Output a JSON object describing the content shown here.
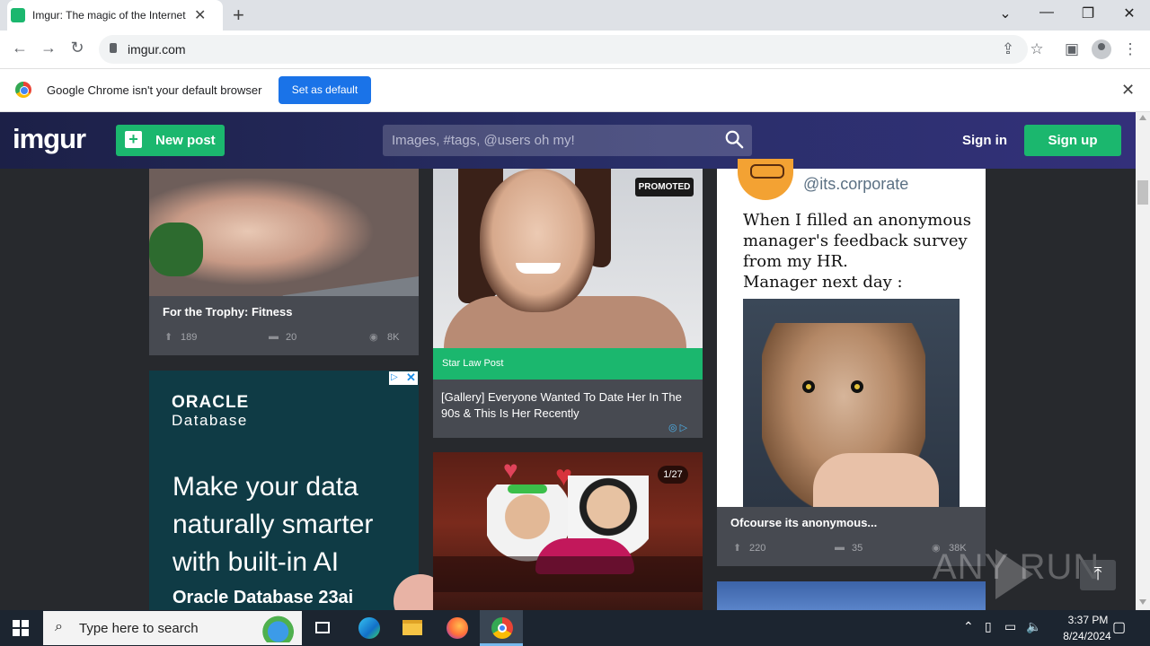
{
  "browser": {
    "tab_title": "Imgur: The magic of the Internet",
    "url": "imgur.com",
    "infobar_text": "Google Chrome isn't your default browser",
    "set_default_label": "Set as default"
  },
  "header": {
    "logo": "imgur",
    "new_post_label": "New post",
    "search_placeholder": "Images, #tags, @users oh my!",
    "signin_label": "Sign in",
    "signup_label": "Sign up"
  },
  "cards": [
    {
      "title": "For the Trophy: Fitness",
      "upvotes": "189",
      "comments": "20",
      "views": "8K"
    },
    {
      "badge": "PROMOTED",
      "source": "Star Law Post",
      "title": "[Gallery] Everyone Wanted To Date Her In The 90s & This Is Her Recently"
    },
    {
      "counter": "1/27"
    },
    {
      "handle": "@its.corporate",
      "meme_text": "When I filled an anonymous manager's feedback survey from my HR.\nManager next day :",
      "title": "Ofcourse its anonymous...",
      "upvotes": "220",
      "comments": "35",
      "views": "38K"
    }
  ],
  "ad": {
    "brand": "ORACLE",
    "product": "Database",
    "headline": "Make your data naturally smarter with built-in AI",
    "cta": "Oracle Database 23ai"
  },
  "watermark": "ANY RUN",
  "taskbar": {
    "search_placeholder": "Type here to search",
    "time": "3:37 PM",
    "date": "8/24/2024"
  },
  "colors": {
    "imgur_green": "#1bb76e",
    "header_navy": "#1c2047",
    "chrome_blue": "#1a73e8"
  }
}
